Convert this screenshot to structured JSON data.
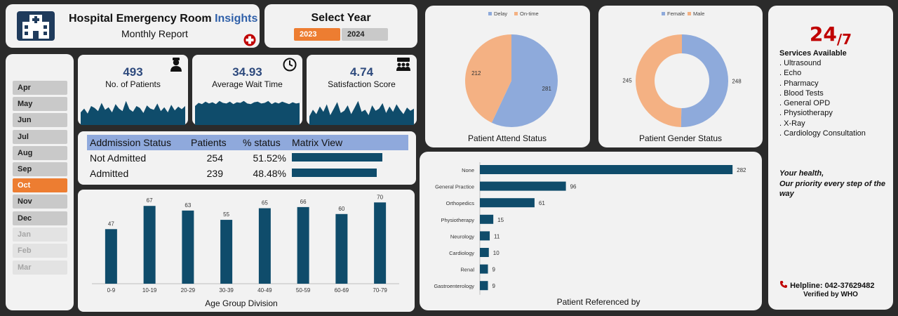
{
  "header": {
    "title_main": "Hospital Emergency Room",
    "title_accent": "Insights",
    "subtitle": "Monthly Report",
    "logo_icon": "hospital-building-icon",
    "cross_icon": "red-cross-icon"
  },
  "year_selector": {
    "label": "Select Year",
    "years": [
      "2023",
      "2024"
    ],
    "selected": "2023"
  },
  "months": {
    "items": [
      "Apr",
      "May",
      "Jun",
      "Jul",
      "Aug",
      "Sep",
      "Oct",
      "Nov",
      "Dec",
      "Jan",
      "Feb",
      "Mar"
    ],
    "selected": "Oct",
    "disabled": [
      "Jan",
      "Feb",
      "Mar"
    ]
  },
  "kpis": [
    {
      "value": "493",
      "label": "No. of Patients",
      "icon": "doctor-icon"
    },
    {
      "value": "34.93",
      "label": "Average Wait Time",
      "icon": "clock-icon"
    },
    {
      "value": "4.74",
      "label": "Satisfaction Score",
      "icon": "review-group-icon"
    }
  ],
  "admission": {
    "headers": [
      "Addmission Status",
      "Patients",
      "% status",
      "Matrix View"
    ],
    "rows": [
      {
        "status": "Not Admitted",
        "patients": "254",
        "pct": "51.52%",
        "ratio": 0.5152
      },
      {
        "status": "Admitted",
        "patients": "239",
        "pct": "48.48%",
        "ratio": 0.4848
      }
    ]
  },
  "colors": {
    "navy": "#0f4c6b",
    "blue": "#8eaadb",
    "orange": "#f4b183",
    "accent": "#ed7d31",
    "red": "#c00000"
  },
  "services": {
    "hours_big": "24",
    "hours_small": "/7",
    "heading": "Services Available",
    "items": [
      ". Ultrasound",
      ". Echo",
      ". Pharmacy",
      ". Blood Tests",
      ". General OPD",
      ". Physiotherapy",
      ". X-Ray",
      ". Cardiology Consultation"
    ],
    "tagline_1": "Your health,",
    "tagline_2": "Our priority every step of the way",
    "helpline": "Helpline: 042-37629482",
    "verified": "Verified by WHO"
  },
  "chart_data": [
    {
      "type": "bar",
      "title": "Age Group Division",
      "categories": [
        "0-9",
        "10-19",
        "20-29",
        "30-39",
        "40-49",
        "50-59",
        "60-69",
        "70-79"
      ],
      "values": [
        47,
        67,
        63,
        55,
        65,
        66,
        60,
        70
      ],
      "ylim": [
        0,
        75
      ]
    },
    {
      "type": "pie",
      "title": "Patient Attend Status",
      "categories": [
        "Delay",
        "On-time"
      ],
      "values": [
        281,
        212
      ],
      "legend": "top"
    },
    {
      "type": "pie",
      "title": "Patient Gender Status",
      "categories": [
        "Female",
        "Male"
      ],
      "values": [
        248,
        245
      ],
      "legend": "top",
      "donut": true
    },
    {
      "type": "bar",
      "orientation": "horizontal",
      "title": "Patient Referenced by",
      "categories": [
        "None",
        "General Practice",
        "Orthopedics",
        "Physiotherapy",
        "Neurology",
        "Cardiology",
        "Renal",
        "Gastroenterology"
      ],
      "values": [
        282,
        96,
        61,
        15,
        11,
        10,
        9,
        9
      ],
      "xlim": [
        0,
        285
      ]
    },
    {
      "type": "area",
      "title": "",
      "series": [
        {
          "values": [
            20,
            26,
            18,
            30,
            27,
            22,
            35,
            24,
            28,
            20,
            33,
            26,
            22,
            38,
            25,
            21,
            30,
            27,
            19,
            31,
            26,
            24,
            34,
            22,
            28,
            20,
            32,
            23,
            29,
            25,
            30
          ]
        },
        {
          "values": [
            30,
            35,
            33,
            37,
            34,
            36,
            33,
            38,
            35,
            34,
            37,
            33,
            36,
            35,
            38,
            34,
            33,
            36,
            37,
            34,
            35,
            38,
            33,
            36,
            34,
            37,
            35,
            33,
            36,
            34,
            35
          ]
        },
        {
          "values": [
            16,
            28,
            20,
            34,
            24,
            38,
            18,
            30,
            42,
            22,
            26,
            36,
            20,
            32,
            44,
            24,
            28,
            18,
            36,
            26,
            30,
            40,
            22,
            34,
            24,
            38,
            28,
            20,
            32,
            26,
            30
          ]
        }
      ]
    }
  ]
}
